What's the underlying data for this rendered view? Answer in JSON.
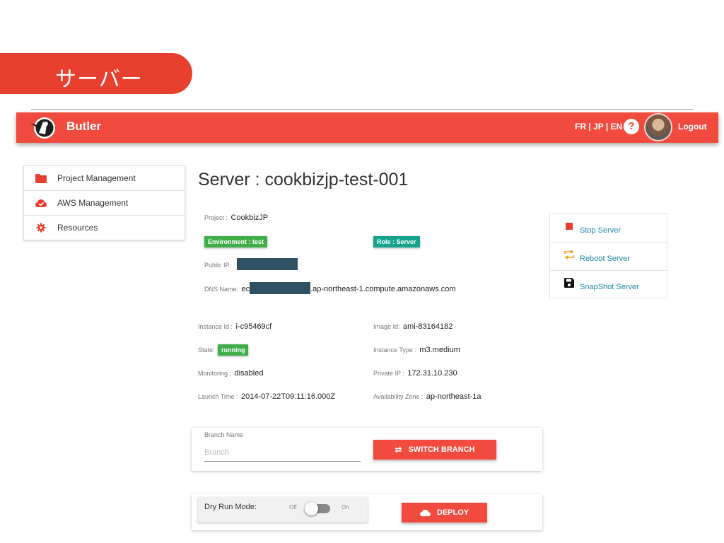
{
  "slide": {
    "title": "サーバー"
  },
  "navbar": {
    "brand": "Butler",
    "languages": "FR | JP | EN",
    "help": "?",
    "logout": "Logout",
    "accent_color": "#f14b3f"
  },
  "sidebar": {
    "items": [
      {
        "label": "Project Management",
        "icon": "folder-icon"
      },
      {
        "label": "AWS Management",
        "icon": "cloud-check-icon"
      },
      {
        "label": "Resources",
        "icon": "gear-icon"
      }
    ]
  },
  "server": {
    "title": "Server : cookbizjp-test-001",
    "project_label": "Project :",
    "project_value": "CookbizJP",
    "environment_chip": "Environment : test",
    "role_chip": "Role : Server",
    "public_ip_label": "Public IP:",
    "dns_label": "DNS Name:",
    "dns_prefix": "ec",
    "dns_suffix": ".ap-northeast-1.compute.amazonaws.com",
    "details": {
      "instance_id_label": "Instance Id :",
      "instance_id_value": "i-c95469cf",
      "state_label": "State:",
      "state_value": "running",
      "monitoring_label": "Monitoring :",
      "monitoring_value": "disabled",
      "launch_time_label": "Launch Time :",
      "launch_time_value": "2014-07-22T09:11:16.000Z",
      "image_id_label": "Image Id:",
      "image_id_value": "ami-83164182",
      "instance_type_label": "Instance Type :",
      "instance_type_value": "m3.medium",
      "private_ip_label": "Private IP :",
      "private_ip_value": "172.31.10.230",
      "az_label": "Availability Zone :",
      "az_value": "ap-northeast-1a"
    }
  },
  "actions": {
    "stop": "Stop Server",
    "reboot": "Reboot Server",
    "snapshot": "SnapShot Server",
    "stop_color": "#e8402f",
    "reboot_color": "#f2a20f"
  },
  "branch": {
    "label": "Branch Name",
    "placeholder": "Branch",
    "button": "SWITCH BRANCH"
  },
  "deploy": {
    "dry_run_label": "Dry Run Mode:",
    "off": "Off",
    "on": "On",
    "dry_run_enabled": false,
    "button": "DEPLOY"
  }
}
